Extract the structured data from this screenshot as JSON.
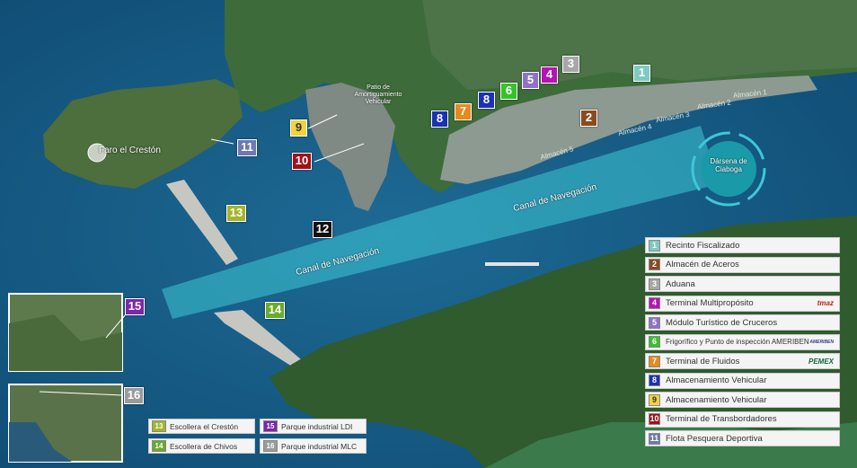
{
  "map_labels": {
    "lighthouse": "Faro el Crestón",
    "buffer_yard": "Patio de Amortiguamiento Vehicular",
    "basin": "Dársena de Ciaboga",
    "channel_label_1": "Canal de Navegación",
    "channel_label_2": "Canal de Navegación",
    "warehouses": [
      "Almacén 5",
      "Almacén 4",
      "Almacén 3",
      "Almacén 2",
      "Almacén 1"
    ]
  },
  "badges": [
    {
      "num": "1",
      "color": "#7fc9c2",
      "text_color": "#ffffff"
    },
    {
      "num": "2",
      "color": "#8a4b1e",
      "text_color": "#ffffff"
    },
    {
      "num": "3",
      "color": "#a7a7a7",
      "text_color": "#ffffff"
    },
    {
      "num": "4",
      "color": "#b414b4",
      "text_color": "#ffffff"
    },
    {
      "num": "5",
      "color": "#8f72c4",
      "text_color": "#ffffff"
    },
    {
      "num": "6",
      "color": "#36c22a",
      "text_color": "#ffffff"
    },
    {
      "num": "7",
      "color": "#e58a1c",
      "text_color": "#ffffff"
    },
    {
      "num": "8",
      "color": "#1a32b4",
      "text_color": "#ffffff"
    },
    {
      "num": "8",
      "color": "#1a32b4",
      "text_color": "#ffffff"
    },
    {
      "num": "9",
      "color": "#f2d33a",
      "text_color": "#333333"
    },
    {
      "num": "10",
      "color": "#a0101a",
      "text_color": "#ffffff"
    },
    {
      "num": "11",
      "color": "#6e78b4",
      "text_color": "#ffffff"
    },
    {
      "num": "12",
      "color": "#111111",
      "text_color": "#ffffff"
    },
    {
      "num": "13",
      "color": "#a3b62a",
      "text_color": "#ffffff"
    },
    {
      "num": "14",
      "color": "#6aaa2c",
      "text_color": "#ffffff"
    },
    {
      "num": "15",
      "color": "#7d26a8",
      "text_color": "#ffffff"
    },
    {
      "num": "16",
      "color": "#9a9a9a",
      "text_color": "#ffffff"
    }
  ],
  "legend": [
    {
      "num": "1",
      "label": "Recinto Fiscalizado",
      "color": "#7fc9c2",
      "text_color": "#ffffff",
      "logo": ""
    },
    {
      "num": "2",
      "label": "Almacén de Aceros",
      "color": "#8a4b1e",
      "text_color": "#ffffff",
      "logo": ""
    },
    {
      "num": "3",
      "label": "Aduana",
      "color": "#a7a7a7",
      "text_color": "#ffffff",
      "logo": ""
    },
    {
      "num": "4",
      "label": "Terminal Multipropósito",
      "color": "#b414b4",
      "text_color": "#ffffff",
      "logo": "tmaz"
    },
    {
      "num": "5",
      "label": "Módulo Turístico de Cruceros",
      "color": "#8f72c4",
      "text_color": "#ffffff",
      "logo": ""
    },
    {
      "num": "6",
      "label": "Frigorífico y Punto de inspección AMERIBEN",
      "color": "#36c22a",
      "text_color": "#ffffff",
      "logo": "AMERIBEN"
    },
    {
      "num": "7",
      "label": "Terminal de Fluidos",
      "color": "#e58a1c",
      "text_color": "#ffffff",
      "logo": "PEMEX"
    },
    {
      "num": "8",
      "label": "Almacenamiento Vehicular",
      "color": "#1a32b4",
      "text_color": "#ffffff",
      "logo": ""
    },
    {
      "num": "9",
      "label": "Almacenamiento Vehicular",
      "color": "#f2d33a",
      "text_color": "#333333",
      "logo": ""
    },
    {
      "num": "10",
      "label": "Terminal de Transbordadores",
      "color": "#a0101a",
      "text_color": "#ffffff",
      "logo": ""
    },
    {
      "num": "11",
      "label": "Flota Pesquera Deportiva",
      "color": "#6e78b4",
      "text_color": "#ffffff",
      "logo": ""
    }
  ],
  "key": [
    {
      "num": "13",
      "label": "Escollera el Crestón",
      "color": "#a3b62a"
    },
    {
      "num": "15",
      "label": "Parque industrial LDI",
      "color": "#7d26a8"
    },
    {
      "num": "14",
      "label": "Escollera de Chivos",
      "color": "#6aaa2c"
    },
    {
      "num": "16",
      "label": "Parque industrial MLC",
      "color": "#9a9a9a"
    }
  ]
}
